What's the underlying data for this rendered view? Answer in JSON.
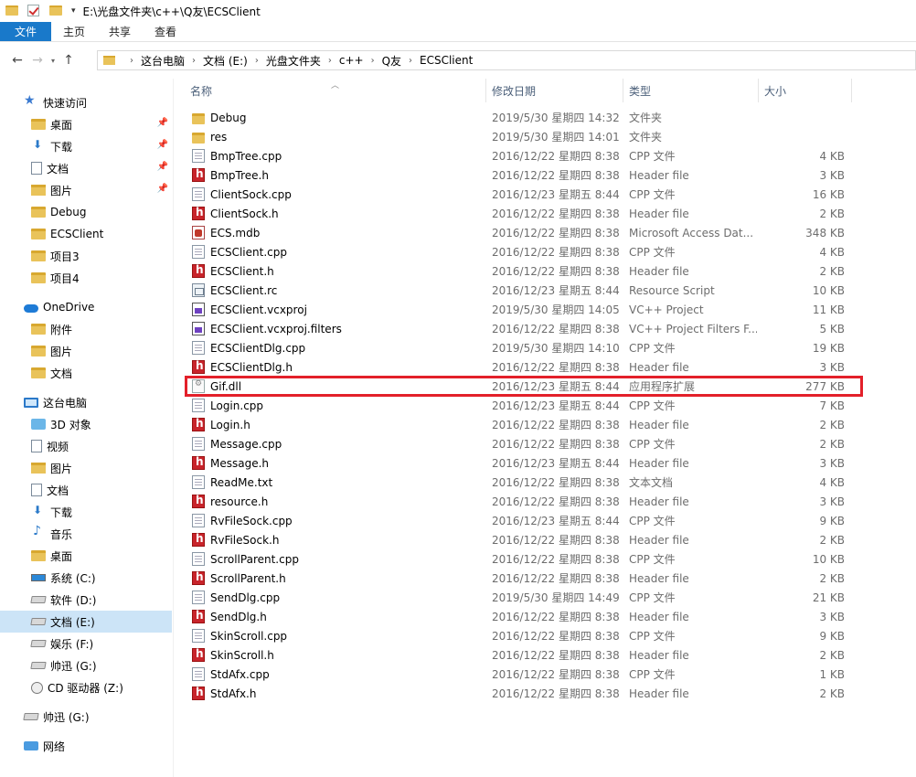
{
  "window": {
    "title": "E:\\光盘文件夹\\c++\\Q友\\ECSClient"
  },
  "ribbon": {
    "file": "文件",
    "tabs": [
      "主页",
      "共享",
      "查看"
    ]
  },
  "address": {
    "crumbs": [
      "这台电脑",
      "文档 (E:)",
      "光盘文件夹",
      "c++",
      "Q友",
      "ECSClient"
    ]
  },
  "nav": {
    "items": [
      {
        "label": "快速访问",
        "icon": "star-icon",
        "level": 0
      },
      {
        "label": "桌面",
        "icon": "folder-icon",
        "level": 1,
        "pinned": true
      },
      {
        "label": "下载",
        "icon": "download-icon",
        "level": 1,
        "pinned": true
      },
      {
        "label": "文档",
        "icon": "document-icon",
        "level": 1,
        "pinned": true
      },
      {
        "label": "图片",
        "icon": "pictures-icon",
        "level": 1,
        "pinned": true
      },
      {
        "label": "Debug",
        "icon": "folder-icon",
        "level": 1
      },
      {
        "label": "ECSClient",
        "icon": "folder-icon",
        "level": 1
      },
      {
        "label": "项目3",
        "icon": "folder-icon",
        "level": 1
      },
      {
        "label": "项目4",
        "icon": "folder-icon",
        "level": 1
      },
      {
        "label": "OneDrive",
        "icon": "cloud-icon",
        "level": 0
      },
      {
        "label": "附件",
        "icon": "folder-icon",
        "level": 1
      },
      {
        "label": "图片",
        "icon": "folder-icon",
        "level": 1
      },
      {
        "label": "文档",
        "icon": "folder-icon",
        "level": 1
      },
      {
        "label": "这台电脑",
        "icon": "computer-icon",
        "level": 0
      },
      {
        "label": "3D 对象",
        "icon": "3d-objects-icon",
        "level": 1
      },
      {
        "label": "视频",
        "icon": "video-icon",
        "level": 1
      },
      {
        "label": "图片",
        "icon": "pictures-icon",
        "level": 1
      },
      {
        "label": "文档",
        "icon": "document-icon",
        "level": 1
      },
      {
        "label": "下载",
        "icon": "download-icon",
        "level": 1
      },
      {
        "label": "音乐",
        "icon": "music-icon",
        "level": 1
      },
      {
        "label": "桌面",
        "icon": "folder-icon",
        "level": 1
      },
      {
        "label": "系统 (C:)",
        "icon": "system-drive-icon",
        "level": 1
      },
      {
        "label": "软件 (D:)",
        "icon": "drive-icon",
        "level": 1
      },
      {
        "label": "文档 (E:)",
        "icon": "drive-icon",
        "level": 1,
        "selected": true
      },
      {
        "label": "娱乐 (F:)",
        "icon": "drive-icon",
        "level": 1
      },
      {
        "label": "帅迅 (G:)",
        "icon": "drive-icon",
        "level": 1
      },
      {
        "label": "CD 驱动器 (Z:)",
        "icon": "cd-drive-icon",
        "level": 1
      },
      {
        "label": "帅迅 (G:)",
        "icon": "drive-icon",
        "level": 0
      },
      {
        "label": "网络",
        "icon": "network-icon",
        "level": 0
      }
    ]
  },
  "columns": {
    "name": "名称",
    "date": "修改日期",
    "type": "类型",
    "size": "大小"
  },
  "files": [
    {
      "name": "Debug",
      "date": "2019/5/30 星期四 14:32",
      "type": "文件夹",
      "size": "",
      "icon": "folder"
    },
    {
      "name": "res",
      "date": "2019/5/30 星期四 14:01",
      "type": "文件夹",
      "size": "",
      "icon": "folder"
    },
    {
      "name": "BmpTree.cpp",
      "date": "2016/12/22 星期四 8:38",
      "type": "CPP 文件",
      "size": "4 KB",
      "icon": "doc"
    },
    {
      "name": "BmpTree.h",
      "date": "2016/12/22 星期四 8:38",
      "type": "Header file",
      "size": "3 KB",
      "icon": "h"
    },
    {
      "name": "ClientSock.cpp",
      "date": "2016/12/23 星期五 8:44",
      "type": "CPP 文件",
      "size": "16 KB",
      "icon": "doc"
    },
    {
      "name": "ClientSock.h",
      "date": "2016/12/22 星期四 8:38",
      "type": "Header file",
      "size": "2 KB",
      "icon": "h"
    },
    {
      "name": "ECS.mdb",
      "date": "2016/12/22 星期四 8:38",
      "type": "Microsoft Access Dat...",
      "size": "348 KB",
      "icon": "mdb"
    },
    {
      "name": "ECSClient.cpp",
      "date": "2016/12/22 星期四 8:38",
      "type": "CPP 文件",
      "size": "4 KB",
      "icon": "doc"
    },
    {
      "name": "ECSClient.h",
      "date": "2016/12/22 星期四 8:38",
      "type": "Header file",
      "size": "2 KB",
      "icon": "h"
    },
    {
      "name": "ECSClient.rc",
      "date": "2016/12/23 星期五 8:44",
      "type": "Resource Script",
      "size": "10 KB",
      "icon": "rc"
    },
    {
      "name": "ECSClient.vcxproj",
      "date": "2019/5/30 星期四 14:05",
      "type": "VC++ Project",
      "size": "11 KB",
      "icon": "proj"
    },
    {
      "name": "ECSClient.vcxproj.filters",
      "date": "2016/12/22 星期四 8:38",
      "type": "VC++ Project Filters F...",
      "size": "5 KB",
      "icon": "proj"
    },
    {
      "name": "ECSClientDlg.cpp",
      "date": "2019/5/30 星期四 14:10",
      "type": "CPP 文件",
      "size": "19 KB",
      "icon": "doc"
    },
    {
      "name": "ECSClientDlg.h",
      "date": "2016/12/22 星期四 8:38",
      "type": "Header file",
      "size": "3 KB",
      "icon": "h"
    },
    {
      "name": "Gif.dll",
      "date": "2016/12/23 星期五 8:44",
      "type": "应用程序扩展",
      "size": "277 KB",
      "icon": "dll",
      "highlighted": true
    },
    {
      "name": "Login.cpp",
      "date": "2016/12/23 星期五 8:44",
      "type": "CPP 文件",
      "size": "7 KB",
      "icon": "doc"
    },
    {
      "name": "Login.h",
      "date": "2016/12/22 星期四 8:38",
      "type": "Header file",
      "size": "2 KB",
      "icon": "h"
    },
    {
      "name": "Message.cpp",
      "date": "2016/12/22 星期四 8:38",
      "type": "CPP 文件",
      "size": "2 KB",
      "icon": "doc"
    },
    {
      "name": "Message.h",
      "date": "2016/12/23 星期五 8:44",
      "type": "Header file",
      "size": "3 KB",
      "icon": "h"
    },
    {
      "name": "ReadMe.txt",
      "date": "2016/12/22 星期四 8:38",
      "type": "文本文档",
      "size": "4 KB",
      "icon": "doc"
    },
    {
      "name": "resource.h",
      "date": "2016/12/22 星期四 8:38",
      "type": "Header file",
      "size": "3 KB",
      "icon": "h"
    },
    {
      "name": "RvFileSock.cpp",
      "date": "2016/12/23 星期五 8:44",
      "type": "CPP 文件",
      "size": "9 KB",
      "icon": "doc"
    },
    {
      "name": "RvFileSock.h",
      "date": "2016/12/22 星期四 8:38",
      "type": "Header file",
      "size": "2 KB",
      "icon": "h"
    },
    {
      "name": "ScrollParent.cpp",
      "date": "2016/12/22 星期四 8:38",
      "type": "CPP 文件",
      "size": "10 KB",
      "icon": "doc"
    },
    {
      "name": "ScrollParent.h",
      "date": "2016/12/22 星期四 8:38",
      "type": "Header file",
      "size": "2 KB",
      "icon": "h"
    },
    {
      "name": "SendDlg.cpp",
      "date": "2019/5/30 星期四 14:49",
      "type": "CPP 文件",
      "size": "21 KB",
      "icon": "doc"
    },
    {
      "name": "SendDlg.h",
      "date": "2016/12/22 星期四 8:38",
      "type": "Header file",
      "size": "3 KB",
      "icon": "h"
    },
    {
      "name": "SkinScroll.cpp",
      "date": "2016/12/22 星期四 8:38",
      "type": "CPP 文件",
      "size": "9 KB",
      "icon": "doc"
    },
    {
      "name": "SkinScroll.h",
      "date": "2016/12/22 星期四 8:38",
      "type": "Header file",
      "size": "2 KB",
      "icon": "h"
    },
    {
      "name": "StdAfx.cpp",
      "date": "2016/12/22 星期四 8:38",
      "type": "CPP 文件",
      "size": "1 KB",
      "icon": "doc"
    },
    {
      "name": "StdAfx.h",
      "date": "2016/12/22 星期四 8:38",
      "type": "Header file",
      "size": "2 KB",
      "icon": "h"
    }
  ],
  "colors": {
    "accent": "#1979ca",
    "selection": "#cce4f7",
    "highlight_box": "#e3202a"
  }
}
